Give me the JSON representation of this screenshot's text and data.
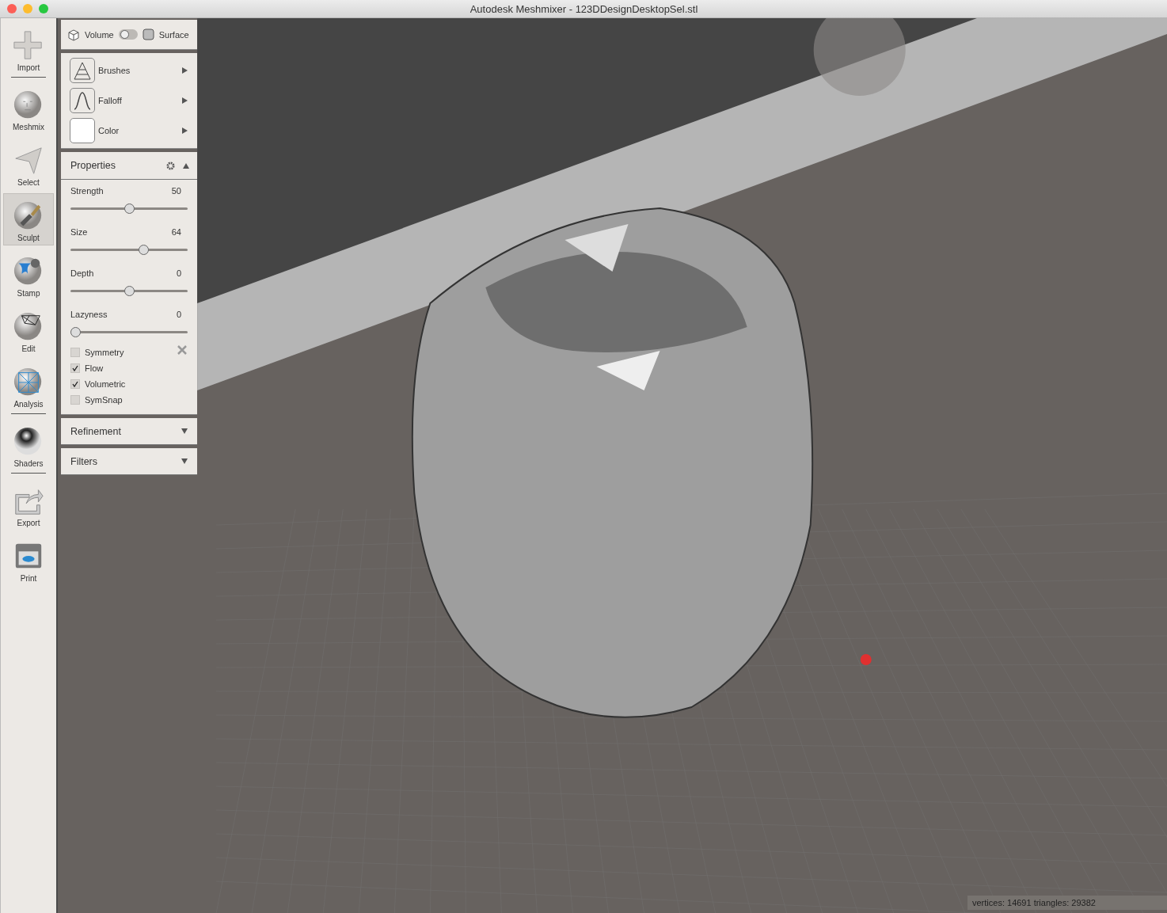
{
  "window": {
    "title": "Autodesk Meshmixer - 123DDesignDesktopSel.stl"
  },
  "tools": [
    {
      "label": "Import",
      "selected": false
    },
    {
      "label": "Meshmix",
      "selected": false
    },
    {
      "label": "Select",
      "selected": false
    },
    {
      "label": "Sculpt",
      "selected": true
    },
    {
      "label": "Stamp",
      "selected": false
    },
    {
      "label": "Edit",
      "selected": false
    },
    {
      "label": "Analysis",
      "selected": false
    },
    {
      "label": "Shaders",
      "selected": false
    },
    {
      "label": "Export",
      "selected": false
    },
    {
      "label": "Print",
      "selected": false
    }
  ],
  "mode": {
    "left": "Volume",
    "right": "Surface",
    "on": false
  },
  "pickers": [
    {
      "label": "Brushes"
    },
    {
      "label": "Falloff"
    },
    {
      "label": "Color"
    }
  ],
  "properties": {
    "title": "Properties",
    "expanded": true,
    "sliders": [
      {
        "name": "Strength",
        "reading": "50",
        "level": 0.5
      },
      {
        "name": "Size",
        "reading": "64",
        "level": 0.63
      },
      {
        "name": "Depth",
        "reading": "0",
        "level": 0.5
      },
      {
        "name": "Lazyness",
        "reading": "0",
        "level": 0
      }
    ],
    "options": [
      {
        "label": "Symmetry",
        "checked": false
      },
      {
        "label": "Flow",
        "checked": true
      },
      {
        "label": "Volumetric",
        "checked": true
      },
      {
        "label": "SymSnap",
        "checked": false
      }
    ]
  },
  "sections": [
    {
      "title": "Refinement",
      "expanded": false
    },
    {
      "title": "Filters",
      "expanded": false
    }
  ],
  "status_bar": "vertices: 14691 triangles: 29382"
}
